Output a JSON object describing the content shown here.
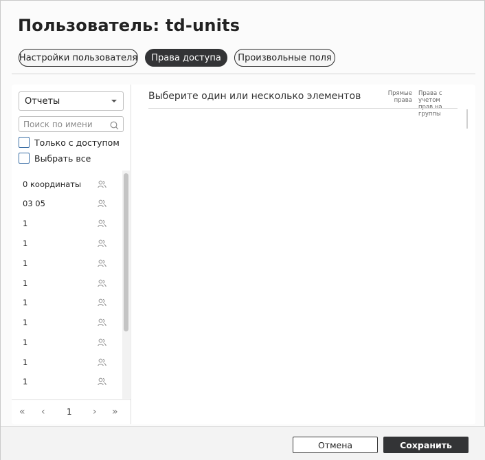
{
  "dialog": {
    "title": "Пользователь: td-units"
  },
  "tabs": [
    {
      "label": "Настройки пользователя",
      "active": false
    },
    {
      "label": "Права доступа",
      "active": true
    },
    {
      "label": "Произвольные поля",
      "active": false
    }
  ],
  "left": {
    "type_select": {
      "value": "Отчеты"
    },
    "search": {
      "placeholder": "Поиск по имени",
      "value": ""
    },
    "only_with_access": {
      "label": "Только с доступом",
      "checked": false
    },
    "select_all": {
      "label": "Выбрать все",
      "checked": false
    },
    "items": [
      "0 координаты",
      "03 05",
      "1",
      "1",
      "1",
      "1",
      "1",
      "1",
      "1",
      "1",
      "1"
    ],
    "pager": {
      "page": "1"
    }
  },
  "right": {
    "title": "Выберите один или несколько элементов",
    "col_direct": [
      "Прямые",
      "права"
    ],
    "col_groups": [
      "Права с учетом",
      "прав на группы"
    ]
  },
  "footer": {
    "cancel": "Отмена",
    "save": "Сохранить"
  },
  "colors": {
    "dark": "#333436",
    "checkbox_border": "#3a6ea5"
  }
}
